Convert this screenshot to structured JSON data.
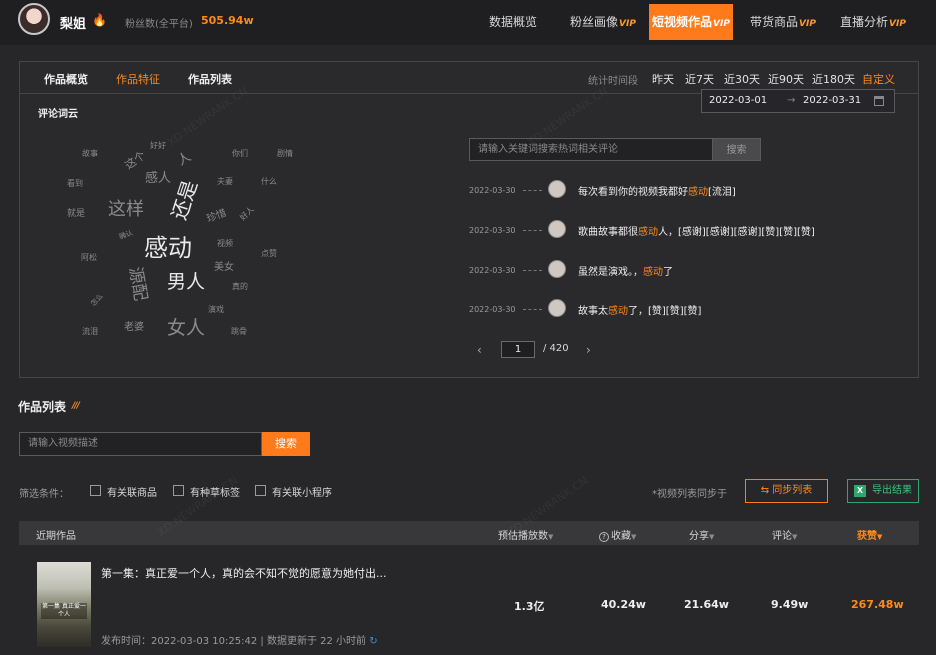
{
  "header": {
    "username": "梨姐",
    "fire_icon": "fire-icon",
    "fans_label": "粉丝数(全平台)",
    "fans_value": "505.94w",
    "nav": [
      {
        "label": "数据概览",
        "vip": ""
      },
      {
        "label": "粉丝画像",
        "vip": "VIP"
      },
      {
        "label": "短视频作品",
        "vip": "VIP"
      },
      {
        "label": "带货商品",
        "vip": "VIP"
      },
      {
        "label": "直播分析",
        "vip": "VIP"
      }
    ],
    "active_nav": "短视频作品"
  },
  "panel": {
    "tabs": [
      "作品概览",
      "作品特征",
      "作品列表"
    ],
    "active_tab": "作品特征",
    "time_label": "统计时间段",
    "ranges": [
      "昨天",
      "近7天",
      "近30天",
      "近90天",
      "近180天",
      "自定义"
    ],
    "active_range": "自定义",
    "date_start": "2022-03-01",
    "date_arrow": "→",
    "date_end": "2022-03-31"
  },
  "word_cloud": {
    "title": "评论词云",
    "words": [
      "故事",
      "这个",
      "好好",
      "人",
      "你们",
      "剧情",
      "看到",
      "感人",
      "还是",
      "夫妻",
      "什么",
      "就是",
      "这样",
      "珍惜",
      "好人",
      "确认",
      "感动",
      "视频",
      "阿松",
      "源配",
      "男人",
      "美女",
      "点赞",
      "真的",
      "怎么",
      "老婆",
      "演戏",
      "流泪",
      "女人",
      "跳骨"
    ]
  },
  "comments": {
    "search_placeholder": "请输入关键词搜索热词相关评论",
    "search_button": "搜索",
    "items": [
      {
        "date": "2022-03-30",
        "before": "每次看到你的视频我都好",
        "highlight": "感动",
        "after": "[流泪]"
      },
      {
        "date": "2022-03-30",
        "before": "歌曲故事都很",
        "highlight": "感动",
        "after": "人，[感谢][感谢][感谢][赞][赞][赞]"
      },
      {
        "date": "2022-03-30",
        "before": "虽然是演戏。，",
        "highlight": "感动",
        "after": "了"
      },
      {
        "date": "2022-03-30",
        "before": "故事太",
        "highlight": "感动",
        "after": "了，[赞][赞][赞]"
      }
    ],
    "pager": {
      "prev": "‹",
      "current": "1",
      "total": "/ 420",
      "next": "›"
    }
  },
  "works": {
    "title": "作品列表",
    "title_deco": "///",
    "search_placeholder": "请输入视频描述",
    "search_button": "搜索",
    "filter_label": "筛选条件：",
    "filters": [
      "有关联商品",
      "有种草标签",
      "有关联小程序"
    ],
    "sync_note": "*视频列表同步于",
    "sync_button": "⇆  同步列表",
    "export_button": "导出结果",
    "export_icon": "X",
    "columns": [
      "近期作品",
      "预估播放数",
      "收藏",
      "分享",
      "评论",
      "获赞"
    ],
    "sort_arrow": "▼",
    "help_icon": "?",
    "rows": [
      {
        "title": "第一集：真正爱一个人，真的会不知不觉的愿意为她付出...",
        "thumb_caption": "第一集 真正爱一个人",
        "plays": "1.3亿",
        "favorites": "40.24w",
        "shares": "21.64w",
        "comments": "9.49w",
        "likes": "267.48w",
        "pub_label": "发布时间：",
        "pub_time": "2022-03-03 10:25:42",
        "divider": "|",
        "update_note": "数据更新于 22 小时前",
        "refresh_icon": "↻"
      }
    ]
  },
  "watermark": "XD.NEWRANK.CN"
}
